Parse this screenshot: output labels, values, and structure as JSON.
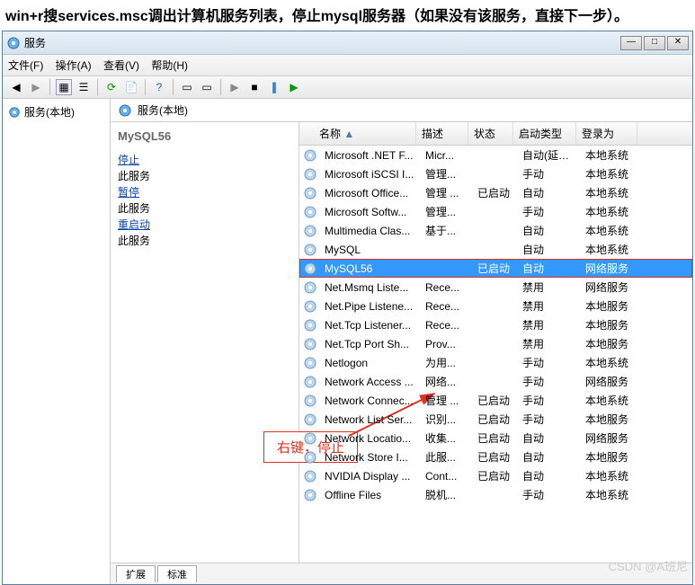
{
  "instruction": "win+r搜services.msc调出计算机服务列表，停止mysql服务器（如果没有该服务，直接下一步）。",
  "window": {
    "title": "服务"
  },
  "menu": {
    "file": "文件(F)",
    "action": "操作(A)",
    "view": "查看(V)",
    "help": "帮助(H)"
  },
  "tree": {
    "root": "服务(本地)"
  },
  "rightHeader": "服务(本地)",
  "detail": {
    "selected": "MySQL56",
    "stop": "停止",
    "stop_suffix": "此服务",
    "pause": "暂停",
    "pause_suffix": "此服务",
    "restart": "重启动",
    "restart_suffix": "此服务"
  },
  "columns": {
    "name": "名称",
    "desc": "描述",
    "status": "状态",
    "startup": "启动类型",
    "logon": "登录为"
  },
  "services": [
    {
      "name": "Microsoft .NET F...",
      "desc": "Micr...",
      "status": "",
      "startup": "自动(延迟...",
      "logon": "本地系统"
    },
    {
      "name": "Microsoft iSCSI I...",
      "desc": "管理...",
      "status": "",
      "startup": "手动",
      "logon": "本地系统"
    },
    {
      "name": "Microsoft Office...",
      "desc": "管理 ...",
      "status": "已启动",
      "startup": "自动",
      "logon": "本地系统"
    },
    {
      "name": "Microsoft Softw...",
      "desc": "管理...",
      "status": "",
      "startup": "手动",
      "logon": "本地系统"
    },
    {
      "name": "Multimedia Clas...",
      "desc": "基于...",
      "status": "",
      "startup": "自动",
      "logon": "本地系统"
    },
    {
      "name": "MySQL",
      "desc": "",
      "status": "",
      "startup": "自动",
      "logon": "本地系统"
    },
    {
      "name": "MySQL56",
      "desc": "",
      "status": "已启动",
      "startup": "自动",
      "logon": "网络服务",
      "selected": true
    },
    {
      "name": "Net.Msmq Liste...",
      "desc": "Rece...",
      "status": "",
      "startup": "禁用",
      "logon": "网络服务"
    },
    {
      "name": "Net.Pipe Listene...",
      "desc": "Rece...",
      "status": "",
      "startup": "禁用",
      "logon": "本地服务"
    },
    {
      "name": "Net.Tcp Listener...",
      "desc": "Rece...",
      "status": "",
      "startup": "禁用",
      "logon": "本地服务"
    },
    {
      "name": "Net.Tcp Port Sh...",
      "desc": "Prov...",
      "status": "",
      "startup": "禁用",
      "logon": "本地服务"
    },
    {
      "name": "Netlogon",
      "desc": "为用...",
      "status": "",
      "startup": "手动",
      "logon": "本地系统"
    },
    {
      "name": "Network Access ...",
      "desc": "网络...",
      "status": "",
      "startup": "手动",
      "logon": "网络服务"
    },
    {
      "name": "Network Connec...",
      "desc": "管理 ...",
      "status": "已启动",
      "startup": "手动",
      "logon": "本地系统"
    },
    {
      "name": "Network List Ser...",
      "desc": "识别...",
      "status": "已启动",
      "startup": "手动",
      "logon": "本地服务"
    },
    {
      "name": "Network Locatio...",
      "desc": "收集...",
      "status": "已启动",
      "startup": "自动",
      "logon": "网络服务"
    },
    {
      "name": "Network Store I...",
      "desc": "此服...",
      "status": "已启动",
      "startup": "自动",
      "logon": "本地服务"
    },
    {
      "name": "NVIDIA Display ...",
      "desc": "Cont...",
      "status": "已启动",
      "startup": "自动",
      "logon": "本地系统"
    },
    {
      "name": "Offline Files",
      "desc": "脱机...",
      "status": "",
      "startup": "手动",
      "logon": "本地系统"
    }
  ],
  "tabs": {
    "ext": "扩展",
    "std": "标准"
  },
  "annotation": "右键，停止",
  "watermark": "CSDN @A班尼"
}
